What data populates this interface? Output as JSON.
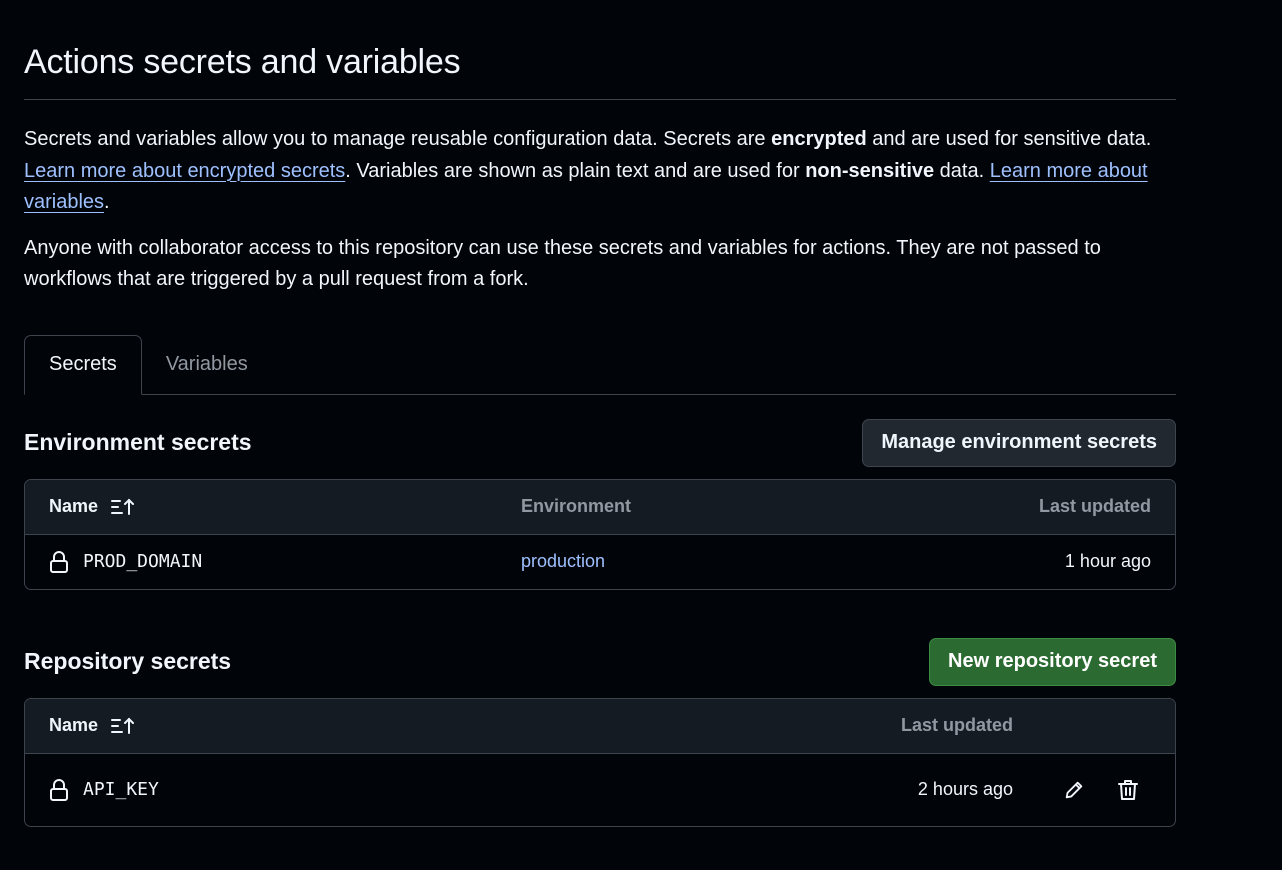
{
  "page": {
    "title": "Actions secrets and variables",
    "intro": {
      "part1": "Secrets and variables allow you to manage reusable configuration data. Secrets are ",
      "bold1": "encrypted",
      "part2": " and are used for sensitive data. ",
      "link1": "Learn more about encrypted secrets",
      "part3": ". Variables are shown as plain text and are used for ",
      "bold2": "non-sensitive",
      "part4": " data. ",
      "link2": "Learn more about variables",
      "part5": "."
    },
    "note": "Anyone with collaborator access to this repository can use these secrets and variables for actions. They are not passed to workflows that are triggered by a pull request from a fork."
  },
  "tabs": [
    {
      "label": "Secrets",
      "active": true
    },
    {
      "label": "Variables",
      "active": false
    }
  ],
  "environment_secrets": {
    "heading": "Environment secrets",
    "button": "Manage environment secrets",
    "columns": {
      "name": "Name",
      "environment": "Environment",
      "updated": "Last updated"
    },
    "rows": [
      {
        "name": "PROD_DOMAIN",
        "environment": "production",
        "updated": "1 hour ago"
      }
    ]
  },
  "repository_secrets": {
    "heading": "Repository secrets",
    "button": "New repository secret",
    "columns": {
      "name": "Name",
      "updated": "Last updated"
    },
    "rows": [
      {
        "name": "API_KEY",
        "updated": "2 hours ago"
      }
    ]
  },
  "icons": {
    "sort": "sort-ascending-icon",
    "lock": "lock-icon",
    "edit": "pencil-icon",
    "delete": "trash-icon"
  },
  "colors": {
    "background": "#010409",
    "link": "#9ec0ff",
    "primary_button": "#2b6a30",
    "border": "#3d444d"
  }
}
